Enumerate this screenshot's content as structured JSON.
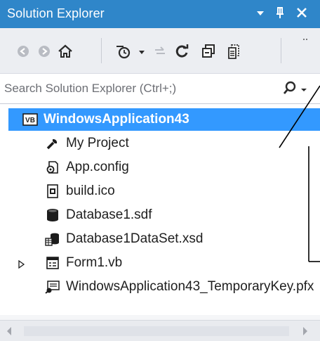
{
  "window": {
    "title": "Solution Explorer",
    "controls": {
      "dropdown_icon": "dropdown-arrow-icon",
      "pin_icon": "pin-icon",
      "close_icon": "close-icon"
    }
  },
  "toolbar": {
    "buttons": [
      {
        "name": "back-button",
        "icon": "back-arrow-icon"
      },
      {
        "name": "forward-button",
        "icon": "forward-arrow-icon"
      },
      {
        "name": "home-button",
        "icon": "home-icon"
      },
      {
        "name": "pending-changes-filter-button",
        "icon": "clock-filter-icon"
      },
      {
        "name": "sync-with-document-button",
        "icon": "sync-icon"
      },
      {
        "name": "refresh-button",
        "icon": "refresh-icon"
      },
      {
        "name": "collapse-all-button",
        "icon": "collapse-all-icon"
      },
      {
        "name": "show-all-files-button",
        "icon": "show-all-files-icon"
      },
      {
        "name": "toolbar-overflow-button",
        "icon": "overflow-icon"
      }
    ]
  },
  "search": {
    "placeholder": "Search Solution Explorer (Ctrl+;)",
    "icon": "search-icon"
  },
  "tree": {
    "project": {
      "label": "WindowsApplication43",
      "icon": "vb-project-icon"
    },
    "items": [
      {
        "label": "My Project",
        "icon": "wrench-icon"
      },
      {
        "label": "App.config",
        "icon": "config-file-icon"
      },
      {
        "label": "build.ico",
        "icon": "icon-file-icon"
      },
      {
        "label": "Database1.sdf",
        "icon": "database-icon"
      },
      {
        "label": "Database1DataSet.xsd",
        "icon": "dataset-icon"
      },
      {
        "label": "Form1.vb",
        "icon": "form-icon",
        "expandable": true
      },
      {
        "label": "WindowsApplication43_TemporaryKey.pfx",
        "icon": "certificate-key-icon"
      }
    ]
  },
  "colors": {
    "title_bar": "#2f86c9",
    "selection": "#3399ff"
  }
}
